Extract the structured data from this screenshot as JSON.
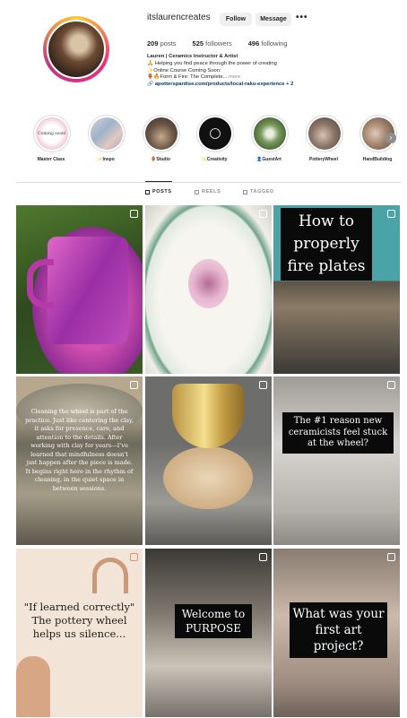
{
  "profile": {
    "username": "itslaurencreates",
    "follow_label": "Follow",
    "message_label": "Message",
    "more_label": "•••",
    "stats": {
      "posts_count": "209",
      "posts_label": "posts",
      "followers_count": "525",
      "followers_label": "followers",
      "following_count": "496",
      "following_label": "following"
    },
    "bio": {
      "name_line": "Lauren | Ceramics Instructor & Artist",
      "line1": "🙏 Helping you find peace through the power of creating",
      "line2": "✨Online Course Coming Soon:",
      "line3_prefix": "🏺🔥Form & Fire: The Complete...",
      "line3_more": "more",
      "link": "🔗 apotterspardise.com/products/local-raku-experience + 2"
    }
  },
  "highlights": [
    {
      "label": "Master Class",
      "cover_text": "Coming soon!"
    },
    {
      "label": "✨Inspo"
    },
    {
      "label": "🏺Studio"
    },
    {
      "label": "✨Creativity"
    },
    {
      "label": "👤GuestArt"
    },
    {
      "label": "PotteryWheel"
    },
    {
      "label": "HandBuilding"
    }
  ],
  "tabs": [
    {
      "label": "POSTS",
      "icon": "grid-icon",
      "active": true
    },
    {
      "label": "REELS",
      "icon": "reels-icon",
      "active": false
    },
    {
      "label": "TAGGED",
      "icon": "tagged-icon",
      "active": false
    }
  ],
  "posts": [
    {
      "type": "pinned",
      "caption": ""
    },
    {
      "type": "pinned",
      "caption": ""
    },
    {
      "type": "reel",
      "caption": "How to properly fire plates"
    },
    {
      "type": "reel",
      "caption": "Cleaning the wheel is part of the practice. Just like centering the clay, it asks for presence, care, and attention to the details. After working with clay for years—I’ve learned that mindfulness doesn’t just happen after the piece is made. It begins right here in the rhythm of cleaning, in the quiet space in between sessions."
    },
    {
      "type": "reel",
      "caption": ""
    },
    {
      "type": "reel",
      "caption": "The #1 reason new ceramicists feel stuck at the wheel?"
    },
    {
      "type": "post",
      "caption": "\"If learned correctly\" The pottery wheel helps us silence..."
    },
    {
      "type": "reel",
      "caption": "Welcome to PURPOSE"
    },
    {
      "type": "reel",
      "caption": "What was your first art project?"
    }
  ]
}
